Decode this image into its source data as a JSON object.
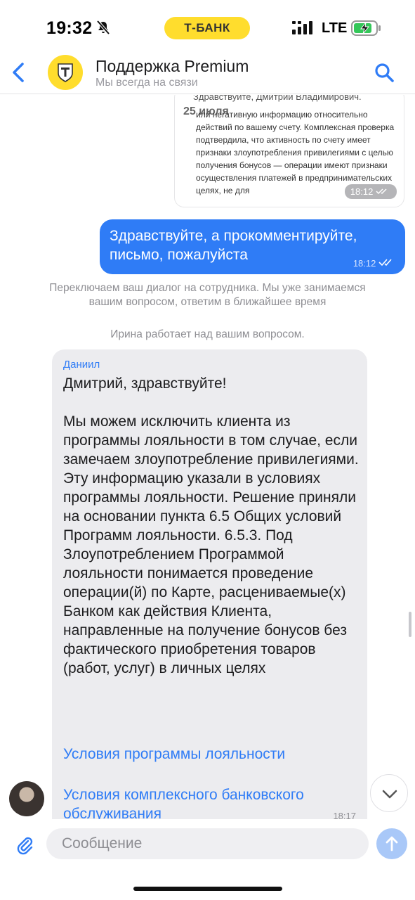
{
  "status_bar": {
    "time": "19:32",
    "brand": "Т-БАНК",
    "network": "LTE"
  },
  "header": {
    "title": "Поддержка Premium",
    "subtitle": "Мы всегда на связи"
  },
  "preview": {
    "greeting": "Здравствуйте, Дмитрий Владимирович.",
    "date": "25 июля",
    "text": "или негативную информацию относительно действий по вашему счету. Комплексная проверка подтвердила, что активность по счету имеет признаки злоупотребления привилегиями с целью получения бонусов — операции имеют признаки осуществления платежей в предпринимательских целях, не для",
    "time": "18:12"
  },
  "outgoing": {
    "text": "Здравствуйте, а прокомментируйте, письмо, пожалуйста",
    "time": "18:12"
  },
  "system": {
    "switch": "Переключаем ваш диалог на сотрудника. Мы уже занимаемся вашим вопросом, ответим в ближайшее время",
    "working": "Ирина работает над вашим вопросом."
  },
  "incoming": {
    "author": "Даниил",
    "text": "Дмитрий, здравствуйте!\n\nМы можем исключить клиента из программы лояльности в том случае, если замечаем злоупотребление привилегиями. Эту информацию указали в условиях программы лояльности. Решение приняли на основании пункта 6.5 Общих условий Программ лояльности. 6.5.3. Под Злоупотреблением Программой лояльности понимается проведение операции(й) по Карте, расцениваемые(х) Банком как действия Клиента, направленные на получение бонусов без фактического приобретения товаров (работ, услуг) в личных целях",
    "link1": "Условия программы лояльности",
    "link2": "Условия комплексного банковского обслуживания",
    "time": "18:17"
  },
  "composer": {
    "placeholder": "Сообщение"
  },
  "colors": {
    "brand_yellow": "#ffdd2d",
    "accent_blue": "#2f7cf6",
    "bubble_gray": "#ececef"
  },
  "icons": [
    "mute-bell-icon",
    "signal-icon",
    "battery-charging-icon",
    "back-chevron-icon",
    "tbank-logo-icon",
    "search-icon",
    "double-check-icon",
    "chevron-down-icon",
    "paperclip-icon",
    "send-arrow-icon"
  ]
}
